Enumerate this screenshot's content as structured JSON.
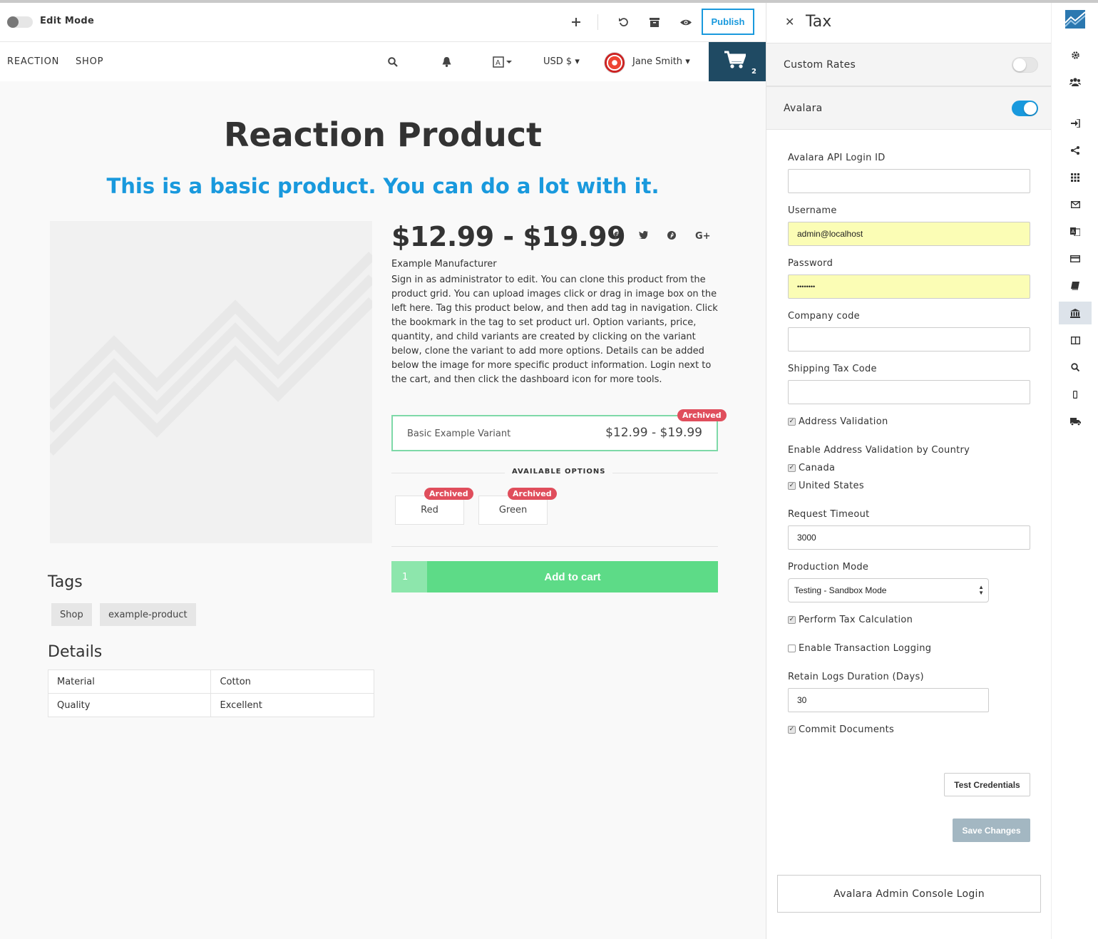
{
  "toolbar": {
    "edit_mode_label": "Edit Mode",
    "publish_label": "Publish"
  },
  "navbar": {
    "brand": "REACTION",
    "links": [
      "SHOP"
    ],
    "currency": "USD $",
    "user_name": "Jane Smith",
    "cart_count": "2"
  },
  "product": {
    "title": "Reaction Product",
    "subtitle": "This is a basic product. You can do a lot with it.",
    "price_range": "$12.99 - $19.99",
    "vendor": "Example Manufacturer",
    "description": "Sign in as administrator to edit. You can clone this product from the product grid. You can upload images click or drag in image box on the left here. Tag this product below, and then add tag in navigation. Click the bookmark in the tag to set product url. Option variants, price, quantity, and child variants are created by clicking on the variant below, clone the variant to add more options. Details can be added below the image for more specific product information. Login next to the cart, and then click the dashboard icon for more tools.",
    "variant": {
      "title": "Basic Example Variant",
      "price": "$12.99 - $19.99",
      "badge": "Archived"
    },
    "available_options_label": "AVAILABLE OPTIONS",
    "options": [
      {
        "label": "Red",
        "badge": "Archived"
      },
      {
        "label": "Green",
        "badge": "Archived"
      }
    ],
    "quantity": "1",
    "add_to_cart_label": "Add to cart",
    "tags_heading": "Tags",
    "tags": [
      "Shop",
      "example-product"
    ],
    "details_heading": "Details",
    "details": [
      {
        "key": "Material",
        "value": "Cotton"
      },
      {
        "key": "Quality",
        "value": "Excellent"
      }
    ]
  },
  "panel": {
    "title": "Tax",
    "sections": [
      {
        "label": "Custom Rates",
        "enabled": false
      },
      {
        "label": "Avalara",
        "enabled": true
      }
    ],
    "fields": {
      "api_login_label": "Avalara API Login ID",
      "api_login_value": "",
      "username_label": "Username",
      "username_value": "admin@localhost",
      "password_label": "Password",
      "password_value": "••••••••",
      "company_code_label": "Company code",
      "company_code_value": "",
      "shipping_tax_code_label": "Shipping Tax Code",
      "shipping_tax_code_value": "",
      "address_validation_label": "Address Validation",
      "address_validation_checked": true,
      "country_validation_label": "Enable Address Validation by Country",
      "countries": [
        {
          "label": "Canada",
          "checked": true
        },
        {
          "label": "United States",
          "checked": true
        }
      ],
      "request_timeout_label": "Request Timeout",
      "request_timeout_value": "3000",
      "production_mode_label": "Production Mode",
      "production_mode_value": "Testing - Sandbox Mode",
      "perform_tax_label": "Perform Tax Calculation",
      "perform_tax_checked": true,
      "transaction_logging_label": "Enable Transaction Logging",
      "transaction_logging_checked": false,
      "retain_logs_label": "Retain Logs Duration (Days)",
      "retain_logs_value": "30",
      "commit_documents_label": "Commit Documents",
      "commit_documents_checked": true
    },
    "test_credentials_label": "Test Credentials",
    "save_changes_label": "Save Changes",
    "console_login_label": "Avalara Admin Console Login"
  },
  "icons": {
    "toolbar": [
      "plus-icon",
      "undo-icon",
      "archive-icon",
      "eye-icon"
    ],
    "social": [
      "facebook-icon",
      "twitter-icon",
      "pinterest-icon",
      "googleplus-icon"
    ],
    "rail": [
      "gear-icon",
      "users-icon",
      "sign-in-icon",
      "share-icon",
      "grid-icon",
      "envelope-icon",
      "language-icon",
      "credit-card-icon",
      "book-icon",
      "bank-icon",
      "columns-icon",
      "search-icon",
      "mobile-icon",
      "truck-icon"
    ]
  },
  "colors": {
    "accent": "#1999dd",
    "cart_bg": "#1f4a63",
    "add_to_cart": "#5ddb87",
    "badge": "#e04e5c",
    "autofill": "#fbfdb5"
  }
}
